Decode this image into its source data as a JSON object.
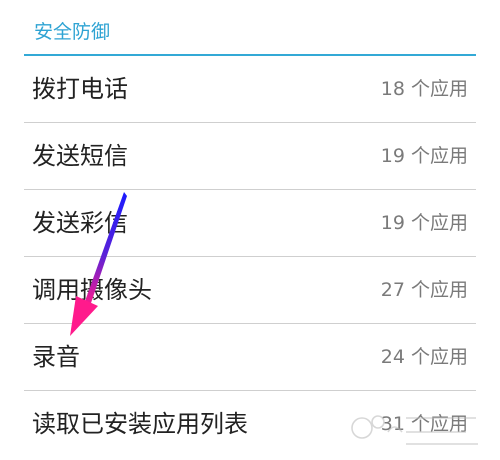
{
  "section": {
    "title": "安全防御"
  },
  "permissions": [
    {
      "label": "拨打电话",
      "count": "18 个应用"
    },
    {
      "label": "发送短信",
      "count": "19 个应用"
    },
    {
      "label": "发送彩信",
      "count": "19 个应用"
    },
    {
      "label": "调用摄像头",
      "count": "27 个应用"
    },
    {
      "label": "录音",
      "count": "24 个应用"
    },
    {
      "label": "读取已安装应用列表",
      "count": "31 个应用"
    }
  ],
  "colors": {
    "accent": "#33a9d6",
    "arrow_start": "#1a1aff",
    "arrow_end": "#ff1a8c"
  },
  "icons": {
    "annotation": "arrow-pointer-icon",
    "watermark": "baidu-jingyan-watermark-icon"
  }
}
